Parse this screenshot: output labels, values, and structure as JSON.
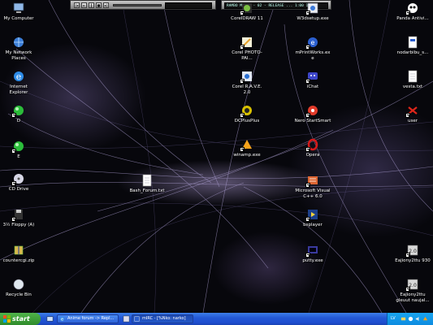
{
  "desktop": {
    "icons": [
      {
        "name": "my-computer",
        "label": "My Computer",
        "icon": "computer-icon"
      },
      {
        "name": "my-network-places",
        "label": "My Network Places",
        "icon": "network-icon"
      },
      {
        "name": "internet-explorer",
        "label": "Internet Explorer",
        "icon": "ie-icon"
      },
      {
        "name": "drive-d",
        "label": "D",
        "icon": "drive-icon"
      },
      {
        "name": "drive-e",
        "label": "E",
        "icon": "drive-icon"
      },
      {
        "name": "cd-drive",
        "label": "CD Drive",
        "icon": "cd-icon"
      },
      {
        "name": "floppy",
        "label": "3½ Floppy (A)",
        "icon": "floppy-icon"
      },
      {
        "name": "counter-cgi",
        "label": "countercgi.zip",
        "icon": "zip-icon"
      },
      {
        "name": "recycle-bin",
        "label": "Recycle Bin",
        "icon": "recycle-bin-icon"
      },
      {
        "name": "corel-draw",
        "label": "CorelDRAW 11",
        "icon": "corel-icon"
      },
      {
        "name": "corel-photo-paint",
        "label": "Corel PHOTO-PAI...",
        "icon": "corel-paint-icon"
      },
      {
        "name": "corel-rave",
        "label": "Corel R.A.V.E. 2.0",
        "icon": "corel-rave-icon"
      },
      {
        "name": "dcplusplus",
        "label": "DCPlusPlus",
        "icon": "dc-icon"
      },
      {
        "name": "winamp",
        "label": "winamp.exe",
        "icon": "winamp-icon"
      },
      {
        "name": "bash-forum",
        "label": "Bash_Forum.txt",
        "icon": "text-file-icon"
      },
      {
        "name": "w3dsetup",
        "label": "W3dsetup.exe",
        "icon": "setup-icon"
      },
      {
        "name": "mirc",
        "label": "mPrintWorks.exe",
        "icon": "mirc-icon"
      },
      {
        "name": "ichat",
        "label": "iChat",
        "icon": "chat-icon"
      },
      {
        "name": "nero",
        "label": "Nero StartSmart",
        "icon": "nero-icon"
      },
      {
        "name": "opera",
        "label": "Opera",
        "icon": "opera-icon"
      },
      {
        "name": "visual-cpp",
        "label": "Microsoft Visual C++ 6.0",
        "icon": "visual-studio-icon"
      },
      {
        "name": "bsplayer",
        "label": "bsplayer",
        "icon": "bsplayer-icon"
      },
      {
        "name": "putty",
        "label": "putty.exe",
        "icon": "putty-icon"
      },
      {
        "name": "panda-antivirus",
        "label": "Panda Antivi...",
        "icon": "panda-icon"
      },
      {
        "name": "nodarbibu",
        "label": "nodarbibu_s...",
        "icon": "document-icon"
      },
      {
        "name": "vesta",
        "label": "vesta.txt",
        "icon": "text-file-icon"
      },
      {
        "name": "user",
        "label": "user",
        "icon": "user-folder-icon"
      },
      {
        "name": "eajiony-1",
        "label": "Eajiony2ttu 930",
        "icon": "app-20-icon"
      },
      {
        "name": "eajiony-2",
        "label": "Eajiony2ttu gleuut naujal...",
        "icon": "app-20-icon"
      }
    ]
  },
  "players": {
    "left_display": "",
    "right_display": "RAMBO MOVIE - 02 - RELEASE ... 1:00  1:55"
  },
  "taskbar": {
    "start_label": "start",
    "tasks": [
      {
        "label": "Anime forum -> Repl...",
        "icon": "ie-icon",
        "active": false
      },
      {
        "name": "mirc-task",
        "label": "mIRC - [%Nko: narko]",
        "icon": "mirc-icon",
        "active": true
      }
    ],
    "tray_lang": "LV"
  },
  "colors": {
    "taskbar": "#245edb",
    "start": "#3c9c36",
    "tray": "#0f8fe5",
    "wallpaper_glow": "#b9a6e6"
  }
}
